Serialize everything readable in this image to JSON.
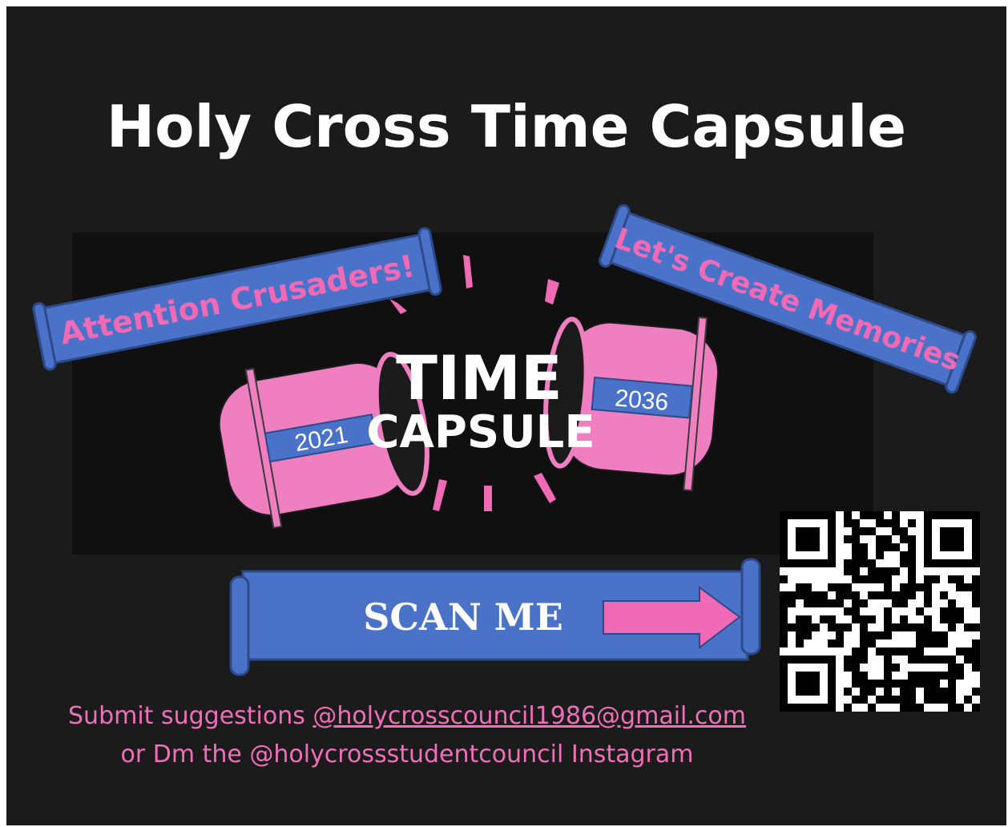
{
  "title": "Holy Cross Time Capsule",
  "banners": {
    "left": "Attention Crusaders!",
    "right": "Let's Create Memories"
  },
  "capsule": {
    "line1": "TIME",
    "line2": "CAPSULE",
    "year_left": "2021",
    "year_right": "2036"
  },
  "scan_label": "SCAN ME",
  "footer": {
    "line1_prefix": "Submit suggestions ",
    "email": "@holycrosscouncil1986@gmail.com",
    "line2": "or Dm the @holycrossstudentcouncil Instagram"
  },
  "colors": {
    "background": "#1b1b1b",
    "banner_blue": "#4a72c9",
    "accent_pink": "#f06ab5",
    "capsule_pink": "#f07fc2"
  },
  "icons": [
    "qr-code-icon",
    "arrow-right-icon"
  ]
}
